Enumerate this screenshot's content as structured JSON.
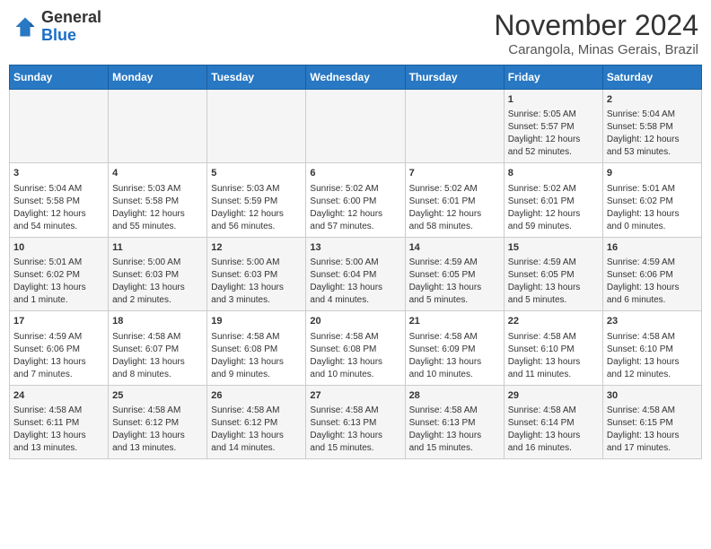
{
  "logo": {
    "line1": "General",
    "line2": "Blue"
  },
  "title": "November 2024",
  "location": "Carangola, Minas Gerais, Brazil",
  "headers": [
    "Sunday",
    "Monday",
    "Tuesday",
    "Wednesday",
    "Thursday",
    "Friday",
    "Saturday"
  ],
  "weeks": [
    [
      {
        "day": "",
        "info": ""
      },
      {
        "day": "",
        "info": ""
      },
      {
        "day": "",
        "info": ""
      },
      {
        "day": "",
        "info": ""
      },
      {
        "day": "",
        "info": ""
      },
      {
        "day": "1",
        "info": "Sunrise: 5:05 AM\nSunset: 5:57 PM\nDaylight: 12 hours\nand 52 minutes."
      },
      {
        "day": "2",
        "info": "Sunrise: 5:04 AM\nSunset: 5:58 PM\nDaylight: 12 hours\nand 53 minutes."
      }
    ],
    [
      {
        "day": "3",
        "info": "Sunrise: 5:04 AM\nSunset: 5:58 PM\nDaylight: 12 hours\nand 54 minutes."
      },
      {
        "day": "4",
        "info": "Sunrise: 5:03 AM\nSunset: 5:58 PM\nDaylight: 12 hours\nand 55 minutes."
      },
      {
        "day": "5",
        "info": "Sunrise: 5:03 AM\nSunset: 5:59 PM\nDaylight: 12 hours\nand 56 minutes."
      },
      {
        "day": "6",
        "info": "Sunrise: 5:02 AM\nSunset: 6:00 PM\nDaylight: 12 hours\nand 57 minutes."
      },
      {
        "day": "7",
        "info": "Sunrise: 5:02 AM\nSunset: 6:01 PM\nDaylight: 12 hours\nand 58 minutes."
      },
      {
        "day": "8",
        "info": "Sunrise: 5:02 AM\nSunset: 6:01 PM\nDaylight: 12 hours\nand 59 minutes."
      },
      {
        "day": "9",
        "info": "Sunrise: 5:01 AM\nSunset: 6:02 PM\nDaylight: 13 hours\nand 0 minutes."
      }
    ],
    [
      {
        "day": "10",
        "info": "Sunrise: 5:01 AM\nSunset: 6:02 PM\nDaylight: 13 hours\nand 1 minute."
      },
      {
        "day": "11",
        "info": "Sunrise: 5:00 AM\nSunset: 6:03 PM\nDaylight: 13 hours\nand 2 minutes."
      },
      {
        "day": "12",
        "info": "Sunrise: 5:00 AM\nSunset: 6:03 PM\nDaylight: 13 hours\nand 3 minutes."
      },
      {
        "day": "13",
        "info": "Sunrise: 5:00 AM\nSunset: 6:04 PM\nDaylight: 13 hours\nand 4 minutes."
      },
      {
        "day": "14",
        "info": "Sunrise: 4:59 AM\nSunset: 6:05 PM\nDaylight: 13 hours\nand 5 minutes."
      },
      {
        "day": "15",
        "info": "Sunrise: 4:59 AM\nSunset: 6:05 PM\nDaylight: 13 hours\nand 5 minutes."
      },
      {
        "day": "16",
        "info": "Sunrise: 4:59 AM\nSunset: 6:06 PM\nDaylight: 13 hours\nand 6 minutes."
      }
    ],
    [
      {
        "day": "17",
        "info": "Sunrise: 4:59 AM\nSunset: 6:06 PM\nDaylight: 13 hours\nand 7 minutes."
      },
      {
        "day": "18",
        "info": "Sunrise: 4:58 AM\nSunset: 6:07 PM\nDaylight: 13 hours\nand 8 minutes."
      },
      {
        "day": "19",
        "info": "Sunrise: 4:58 AM\nSunset: 6:08 PM\nDaylight: 13 hours\nand 9 minutes."
      },
      {
        "day": "20",
        "info": "Sunrise: 4:58 AM\nSunset: 6:08 PM\nDaylight: 13 hours\nand 10 minutes."
      },
      {
        "day": "21",
        "info": "Sunrise: 4:58 AM\nSunset: 6:09 PM\nDaylight: 13 hours\nand 10 minutes."
      },
      {
        "day": "22",
        "info": "Sunrise: 4:58 AM\nSunset: 6:10 PM\nDaylight: 13 hours\nand 11 minutes."
      },
      {
        "day": "23",
        "info": "Sunrise: 4:58 AM\nSunset: 6:10 PM\nDaylight: 13 hours\nand 12 minutes."
      }
    ],
    [
      {
        "day": "24",
        "info": "Sunrise: 4:58 AM\nSunset: 6:11 PM\nDaylight: 13 hours\nand 13 minutes."
      },
      {
        "day": "25",
        "info": "Sunrise: 4:58 AM\nSunset: 6:12 PM\nDaylight: 13 hours\nand 13 minutes."
      },
      {
        "day": "26",
        "info": "Sunrise: 4:58 AM\nSunset: 6:12 PM\nDaylight: 13 hours\nand 14 minutes."
      },
      {
        "day": "27",
        "info": "Sunrise: 4:58 AM\nSunset: 6:13 PM\nDaylight: 13 hours\nand 15 minutes."
      },
      {
        "day": "28",
        "info": "Sunrise: 4:58 AM\nSunset: 6:13 PM\nDaylight: 13 hours\nand 15 minutes."
      },
      {
        "day": "29",
        "info": "Sunrise: 4:58 AM\nSunset: 6:14 PM\nDaylight: 13 hours\nand 16 minutes."
      },
      {
        "day": "30",
        "info": "Sunrise: 4:58 AM\nSunset: 6:15 PM\nDaylight: 13 hours\nand 17 minutes."
      }
    ]
  ]
}
